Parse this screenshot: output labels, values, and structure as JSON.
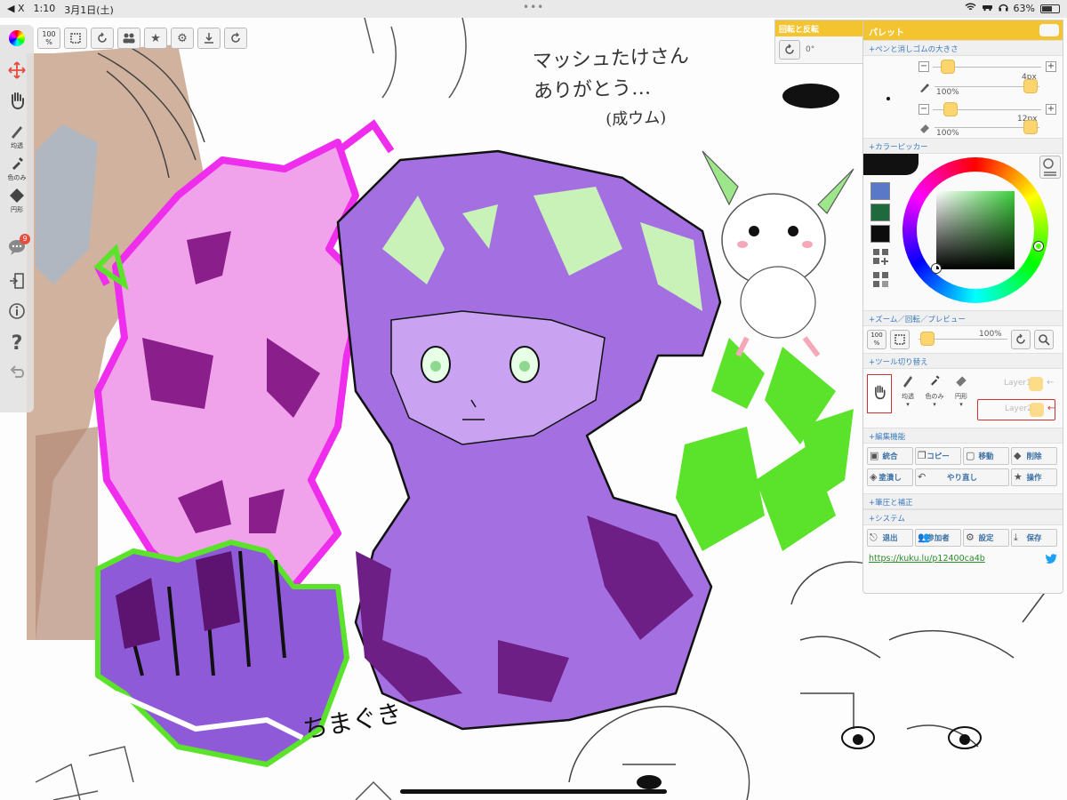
{
  "status_bar": {
    "back_label": "◀ X",
    "time": "1:10",
    "date": "3月1日(土)",
    "dots": "•••",
    "battery": "63%",
    "battery_level": 0.63
  },
  "canvas_text": {
    "handwritten_lines": [
      "マッシュたけさん",
      "ありがとう…",
      "(成ウム)"
    ],
    "signature": "ちまぐき"
  },
  "top_toolbar": {
    "zoom_value": "100",
    "zoom_unit": "%"
  },
  "left_rail": {
    "labels": {
      "smudge": "均透",
      "eyedropper": "色のみ",
      "shape": "円形"
    },
    "chat_badge": "9"
  },
  "rotate_panel": {
    "title": "回転と反転",
    "value": "0°"
  },
  "palette": {
    "title": "パレット",
    "pen_section": "+ペンと消しゴムの大きさ",
    "pen": {
      "size": "4px",
      "opacity": "100%"
    },
    "eraser": {
      "size": "12px",
      "opacity": "100%"
    },
    "color_section": "+カラーピッカー",
    "current_color": "#111111",
    "swatches": [
      "#5a78c8",
      "#1f6a3c",
      "#0d0d0d"
    ],
    "zoom_section": "+ズーム／回転／プレビュー",
    "zoom_button": "100",
    "zoom_button_unit": "%",
    "zoom_value": "100%",
    "tool_section": "+ツール切り替え",
    "tools": {
      "smudge": "均透",
      "eyedropper": "色のみ",
      "shape": "円形"
    },
    "layers": [
      "Layer1",
      "Layer2"
    ],
    "edit_section": "+編集機能",
    "edit_buttons": {
      "merge": "統合",
      "copy": "コピー",
      "move": "移動",
      "delete": "削除",
      "fill": "塗潰し",
      "redo": "やり直し",
      "operate": "操作"
    },
    "pressure_section": "+筆圧と補正",
    "system_section": "+システム",
    "system_buttons": {
      "exit": "退出",
      "participants": "参加者",
      "settings": "設定",
      "save": "保存"
    },
    "url": "https://kuku.lu/p12400ca4b"
  },
  "colors": {
    "accent": "#f4c430",
    "section_text": "#3a7bbf",
    "knob": "#fcd56e",
    "link": "#2a8b2a"
  }
}
